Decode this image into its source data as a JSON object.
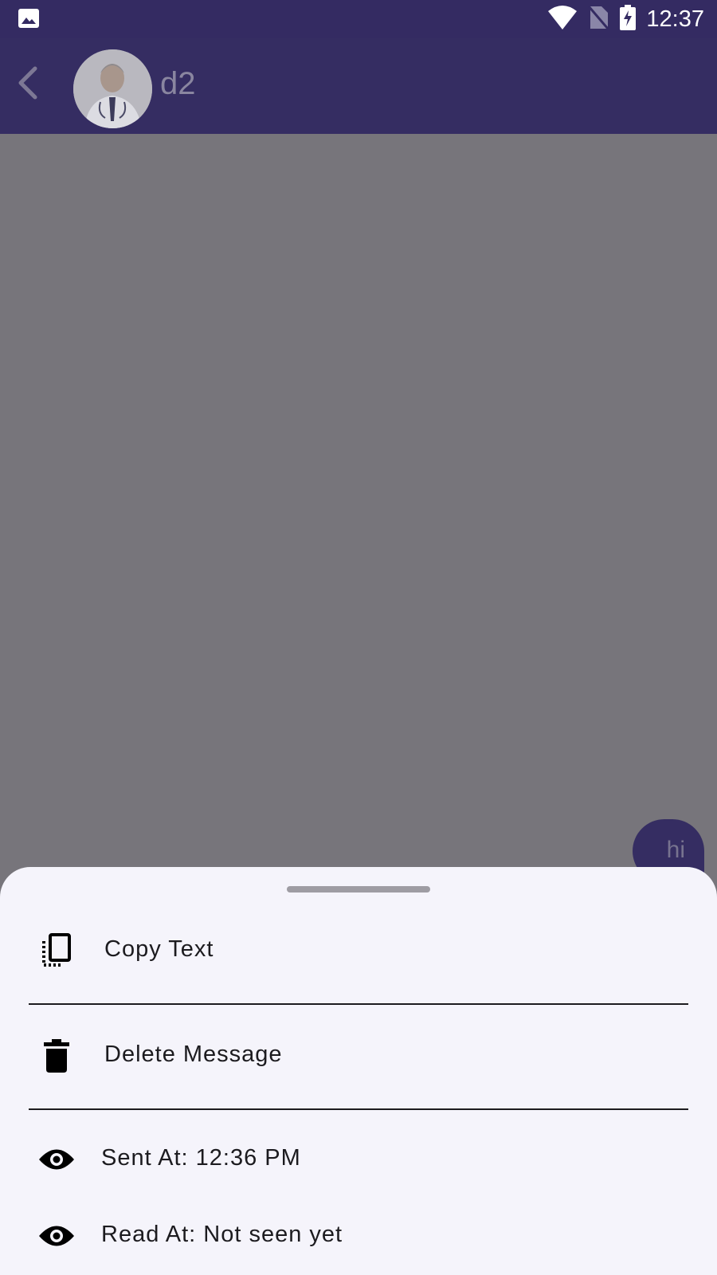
{
  "status_bar": {
    "time": "12:37",
    "icons": [
      "image-notification-icon",
      "wifi-icon",
      "no-sim-icon",
      "battery-charging-icon"
    ]
  },
  "app_bar": {
    "back_icon": "chevron-left-icon",
    "contact_name": "d2",
    "color": "#352d62"
  },
  "chat": {
    "messages": [
      {
        "text": "hi",
        "outgoing": true
      }
    ]
  },
  "bottom_sheet": {
    "actions": [
      {
        "icon": "copy-icon",
        "label": "Copy Text"
      },
      {
        "icon": "trash-icon",
        "label": "Delete Message"
      }
    ],
    "info": [
      {
        "icon": "eye-icon",
        "label": "Sent At: 12:36 PM"
      },
      {
        "icon": "eye-icon",
        "label": "Read At: Not seen yet"
      }
    ]
  },
  "colors": {
    "primary": "#352d62",
    "scrim": "#77757b",
    "sheet_background": "#f5f4fb"
  }
}
